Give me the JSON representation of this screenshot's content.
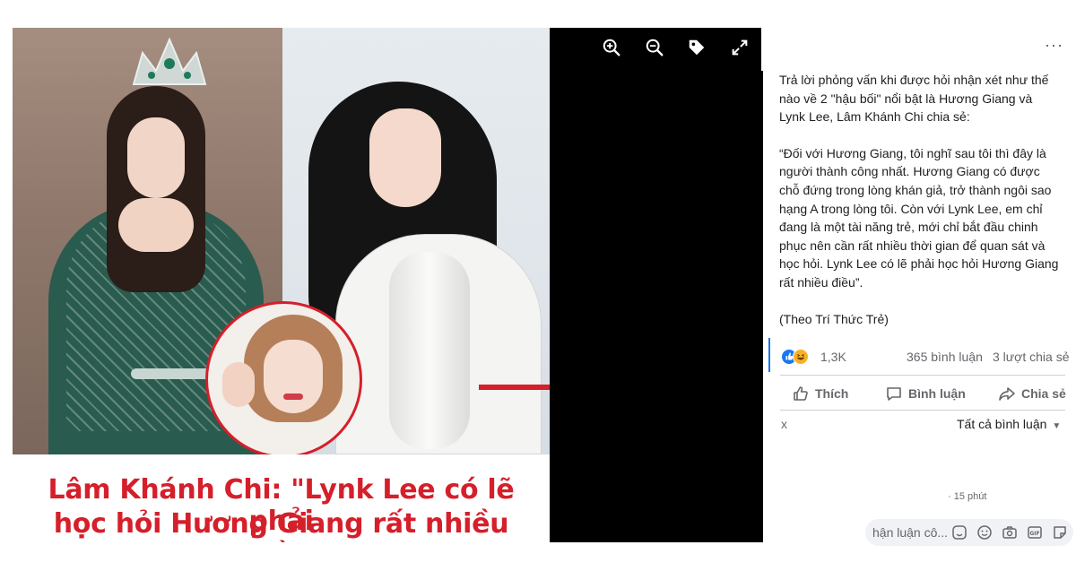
{
  "viewer": {
    "toolbar": {
      "zoom_in": "zoom-in-icon",
      "zoom_out": "zoom-out-icon",
      "tag": "tag-icon",
      "fullscreen": "fullscreen-icon"
    }
  },
  "photo": {
    "caption_line1": "Lâm Khánh Chi: \"Lynk Lee có lẽ phải",
    "caption_line2": "học hỏi Hương Giang rất nhiều điều\"",
    "accent_color": "#d51f2a"
  },
  "post": {
    "more": "···",
    "paragraphs": [
      [
        "Trả lời phỏng vấn khi được hỏi nhận xét như thế",
        "nào về 2 \"hậu bối\" nổi bật là Hương Giang và",
        "Lynk Lee, Lâm Khánh Chi chia sẻ:"
      ],
      [
        "“Đối với Hương Giang, tôi nghĩ sau tôi thì đây là",
        "người thành công nhất. Hương Giang có được",
        "chỗ đứng trong lòng khán giả, trở thành ngôi sao",
        "hạng A trong lòng tôi. Còn với Lynk Lee, em chỉ",
        "đang là một tài năng trẻ, mới chỉ bắt đầu chinh",
        "phục nên cần rất nhiều thời gian để quan sát và",
        "học hỏi. Lynk Lee có lẽ phải học hỏi Hương Giang",
        "rất nhiều điều”."
      ],
      [
        "(Theo Trí Thức Trẻ)"
      ]
    ],
    "reactions": {
      "count": "1,3K",
      "comments": "365 bình luận",
      "shares": "3 lượt chia sẻ"
    },
    "actions": {
      "like": "Thích",
      "comment": "Bình luận",
      "share": "Chia sẻ"
    },
    "sort_label": "Tất cả bình luận",
    "x_mark": "x",
    "time": "· 15 phút",
    "comment_placeholder": "hận luận cô...",
    "brand_color": "#1877f2"
  }
}
